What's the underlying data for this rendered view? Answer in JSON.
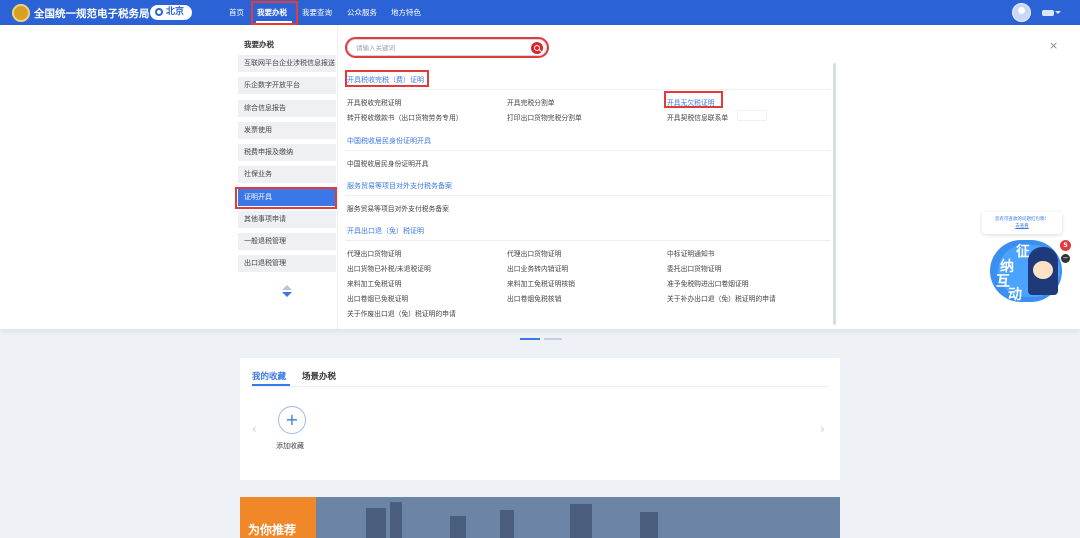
{
  "header": {
    "site_title": "全国统一规范电子税务局",
    "city": "北京",
    "nav": [
      {
        "label": "首页"
      },
      {
        "label": "我要办税"
      },
      {
        "label": "我要查询"
      },
      {
        "label": "公众服务"
      },
      {
        "label": "地方特色"
      }
    ]
  },
  "sidebar": {
    "title": "我要办税",
    "items": [
      {
        "label": "互联网平台企业涉税信息报送"
      },
      {
        "label": "乐企数字开放平台"
      },
      {
        "label": "综合信息报告"
      },
      {
        "label": "发票使用"
      },
      {
        "label": "税费申报及缴纳"
      },
      {
        "label": "社保业务"
      },
      {
        "label": "证明开具"
      },
      {
        "label": "其他事项申请"
      },
      {
        "label": "一般退税管理"
      },
      {
        "label": "出口退税管理"
      }
    ]
  },
  "search": {
    "placeholder": "请输入关键词"
  },
  "close_symbol": "×",
  "sections": [
    {
      "title": "开具税收完税（费）证明",
      "links": [
        {
          "label": "开具税收完税证明"
        },
        {
          "label": "开具完税分割单"
        },
        {
          "label": "开具无欠税证明"
        },
        {
          "label": "转开税收缴款书（出口货物劳务专用）"
        },
        {
          "label": "打印出口货物完税分割单"
        },
        {
          "label": "开具契税信息联系单"
        }
      ]
    },
    {
      "title": "中国税收居民身份证明开具",
      "links": [
        {
          "label": "中国税收居民身份证明开具"
        }
      ]
    },
    {
      "title": "服务贸易等项目对外支付税务备案",
      "links": [
        {
          "label": "服务贸易等项目对外支付税务备案"
        }
      ]
    },
    {
      "title": "开具出口退（免）税证明",
      "links": [
        {
          "label": "代理出口货物证明"
        },
        {
          "label": "代理出口货物证明"
        },
        {
          "label": "中标证明通知书"
        },
        {
          "label": "出口货物已补税/未退税证明"
        },
        {
          "label": "出口业务转内销证明"
        },
        {
          "label": "委托出口货物证明"
        },
        {
          "label": "来料加工免税证明"
        },
        {
          "label": "来料加工免税证明核销"
        },
        {
          "label": "准予免税购进出口卷烟证明"
        },
        {
          "label": "出口卷烟已免税证明"
        },
        {
          "label": "出口卷烟免税核销"
        },
        {
          "label": "关于补办出口退（免）税证明的申请"
        },
        {
          "label": "关于作废出口退（免）税证明的申请"
        }
      ]
    }
  ],
  "favorites": {
    "tabs": [
      {
        "label": "我的收藏"
      },
      {
        "label": "场景办税"
      }
    ],
    "add_symbol": "+",
    "add_label": "添加收藏",
    "prev_arrow": "‹",
    "next_arrow": "›"
  },
  "recommend": {
    "label": "为你推荐"
  },
  "assistant": {
    "bubble_line1": "您有可查收的问题红包噢！",
    "bubble_line2": "去查看",
    "chars": [
      "征",
      "纳",
      "互",
      "动"
    ],
    "badge_count": "5",
    "minimize_symbol": "−"
  },
  "colors": {
    "brand_blue": "#2b63d6",
    "link_blue": "#3a78e8",
    "highlight_red": "#e23b3b",
    "accent_orange": "#f0882a"
  }
}
